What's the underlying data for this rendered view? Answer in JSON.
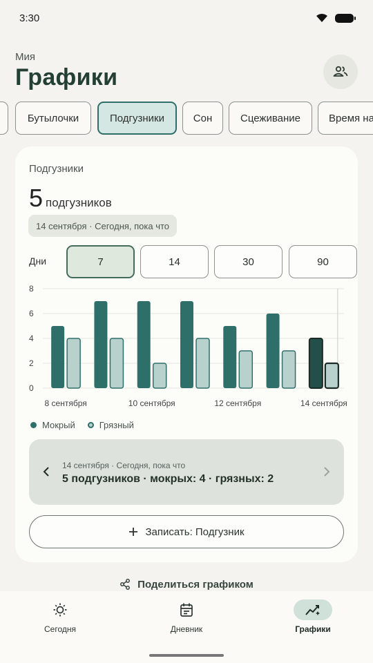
{
  "status_bar": {
    "time": "3:30"
  },
  "header": {
    "subtitle": "Мия",
    "title": "Графики"
  },
  "tabs": [
    {
      "label": ""
    },
    {
      "label": "Бутылочки"
    },
    {
      "label": "Подгузники"
    },
    {
      "label": "Сон"
    },
    {
      "label": "Сцеживание"
    },
    {
      "label": "Время на"
    }
  ],
  "card": {
    "title": "Подгузники",
    "total_value": "5",
    "total_unit": "подгузников",
    "range": "14 сентября · Сегодня, пока что",
    "days_label": "Дни",
    "days_options": [
      "7",
      "14",
      "30",
      "90"
    ],
    "days_selected": "7"
  },
  "legend": {
    "wet": "Мокрый",
    "dirty": "Грязный"
  },
  "summary": {
    "date": "14 сентября · Сегодня, пока что",
    "text": "5 подгузников · мокрых: 4 · грязных: 2"
  },
  "record_button": "Записать: Подгузник",
  "share_button": "Поделиться графиком",
  "nav": [
    {
      "label": "Сегодня"
    },
    {
      "label": "Дневник"
    },
    {
      "label": "Графики"
    }
  ],
  "colors": {
    "wet": "#2f6f6a",
    "dirty": "#b9d1cd",
    "accent": "#2f6d69"
  },
  "chart_data": {
    "type": "bar",
    "categories": [
      "8 сентября",
      "9 сентября",
      "10 сентября",
      "11 сентября",
      "12 сентября",
      "13 сентября",
      "14 сентября"
    ],
    "x_tick_labels": [
      "8 сентября",
      "10 сентября",
      "12 сентября",
      "14 сентября"
    ],
    "series": [
      {
        "name": "Мокрый",
        "values": [
          5,
          7,
          7,
          7,
          5,
          6,
          4
        ]
      },
      {
        "name": "Грязный",
        "values": [
          4,
          4,
          2,
          4,
          3,
          3,
          2
        ]
      }
    ],
    "ylim": [
      0,
      8
    ],
    "y_ticks": [
      0,
      2,
      4,
      6,
      8
    ],
    "highlighted_category": "14 сентября",
    "grid": true,
    "legend_position": "bottom-left"
  }
}
